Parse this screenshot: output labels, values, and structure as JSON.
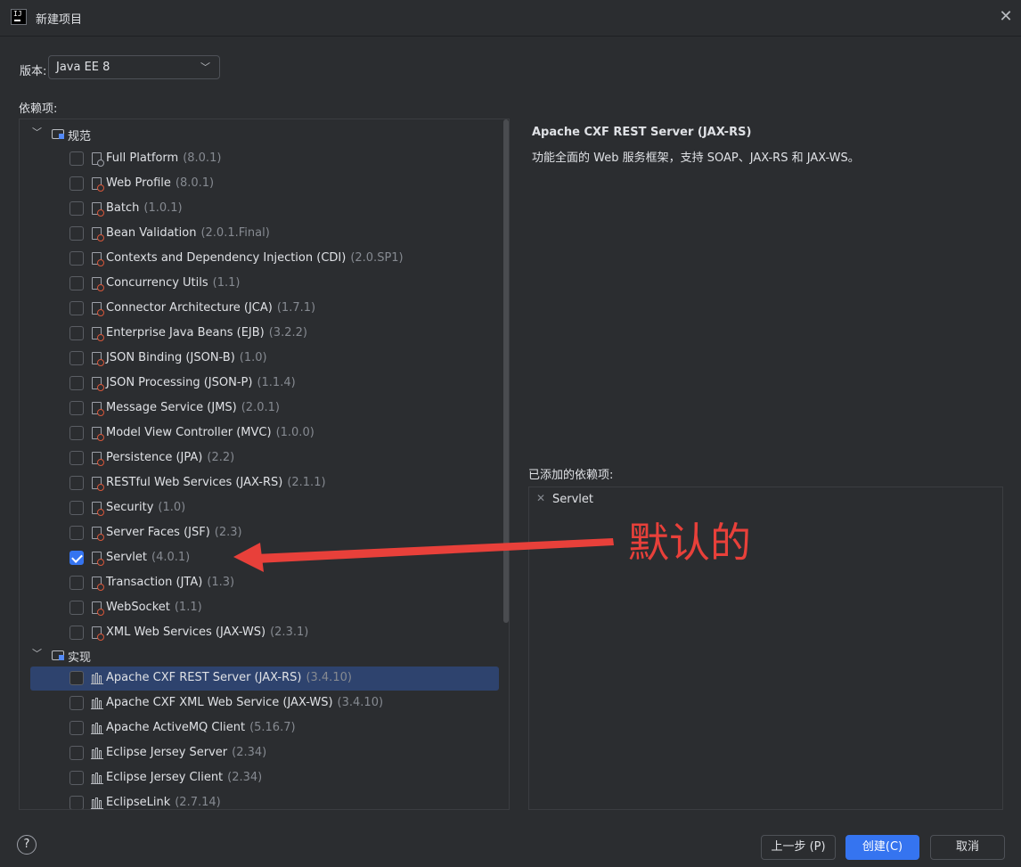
{
  "window": {
    "title": "新建项目",
    "close_icon": "close-icon"
  },
  "version": {
    "label": "版本:",
    "value": "Java EE 8"
  },
  "deps_label": "依赖项:",
  "tree": {
    "categories": [
      {
        "label": "规范",
        "icon": "folder-icon"
      },
      {
        "label": "实现",
        "icon": "folder-icon"
      }
    ],
    "spec_items": [
      {
        "name": "Full Platform",
        "version": "(8.0.1)",
        "checked": false
      },
      {
        "name": "Web Profile",
        "version": "(8.0.1)",
        "checked": false
      },
      {
        "name": "Batch",
        "version": "(1.0.1)",
        "checked": false
      },
      {
        "name": "Bean Validation",
        "version": "(2.0.1.Final)",
        "checked": false
      },
      {
        "name": "Contexts and Dependency Injection (CDI)",
        "version": "(2.0.SP1)",
        "checked": false
      },
      {
        "name": "Concurrency Utils",
        "version": "(1.1)",
        "checked": false
      },
      {
        "name": "Connector Architecture (JCA)",
        "version": "(1.7.1)",
        "checked": false
      },
      {
        "name": "Enterprise Java Beans (EJB)",
        "version": "(3.2.2)",
        "checked": false
      },
      {
        "name": "JSON Binding (JSON-B)",
        "version": "(1.0)",
        "checked": false
      },
      {
        "name": "JSON Processing (JSON-P)",
        "version": "(1.1.4)",
        "checked": false
      },
      {
        "name": "Message Service (JMS)",
        "version": "(2.0.1)",
        "checked": false
      },
      {
        "name": "Model View Controller (MVC)",
        "version": "(1.0.0)",
        "checked": false
      },
      {
        "name": "Persistence (JPA)",
        "version": "(2.2)",
        "checked": false
      },
      {
        "name": "RESTful Web Services (JAX-RS)",
        "version": "(2.1.1)",
        "checked": false
      },
      {
        "name": "Security",
        "version": "(1.0)",
        "checked": false
      },
      {
        "name": "Server Faces (JSF)",
        "version": "(2.3)",
        "checked": false
      },
      {
        "name": "Servlet",
        "version": "(4.0.1)",
        "checked": true
      },
      {
        "name": "Transaction (JTA)",
        "version": "(1.3)",
        "checked": false
      },
      {
        "name": "WebSocket",
        "version": "(1.1)",
        "checked": false
      },
      {
        "name": "XML Web Services (JAX-WS)",
        "version": "(2.3.1)",
        "checked": false
      }
    ],
    "impl_items": [
      {
        "name": "Apache CXF REST Server (JAX-RS)",
        "version": "(3.4.10)",
        "checked": false,
        "selected": true
      },
      {
        "name": "Apache CXF XML Web Service (JAX-WS)",
        "version": "(3.4.10)",
        "checked": false
      },
      {
        "name": "Apache ActiveMQ Client",
        "version": "(5.16.7)",
        "checked": false
      },
      {
        "name": "Eclipse Jersey Server",
        "version": "(2.34)",
        "checked": false
      },
      {
        "name": "Eclipse Jersey Client",
        "version": "(2.34)",
        "checked": false
      },
      {
        "name": "EclipseLink",
        "version": "(2.7.14)",
        "checked": false
      }
    ]
  },
  "detail": {
    "title": "Apache CXF REST Server (JAX-RS)",
    "description": "功能全面的 Web 服务框架，支持 SOAP、JAX-RS 和 JAX-WS。"
  },
  "added": {
    "label": "已添加的依赖项:",
    "items": [
      "Servlet"
    ]
  },
  "annotation": {
    "text": "默认的",
    "color": "#e8403a"
  },
  "buttons": {
    "help": "?",
    "prev": "上一步 (P)",
    "create": "创建(C)",
    "cancel": "取消"
  },
  "colors": {
    "accent": "#3574f0",
    "background": "#2b2d30",
    "selection": "#2e436e"
  }
}
